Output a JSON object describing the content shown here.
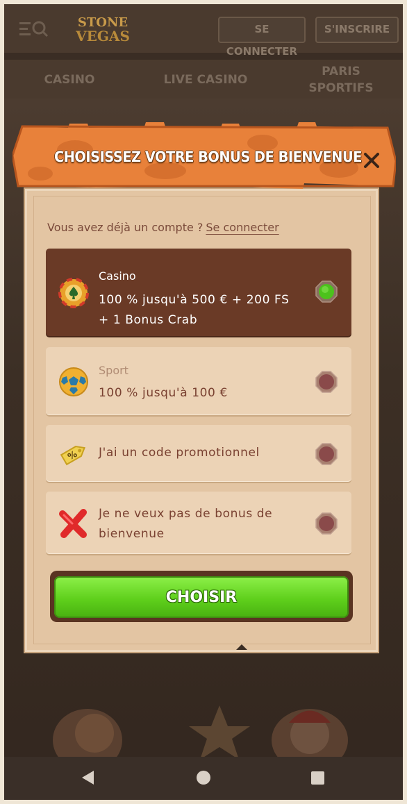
{
  "header": {
    "logo_top": "STONE",
    "logo_bottom": "VEGAS",
    "login_label": "SE CONNECTER",
    "register_label": "S'INSCRIRE"
  },
  "nav": {
    "tabs": [
      {
        "label": "CASINO"
      },
      {
        "label": "LIVE CASINO"
      },
      {
        "label": "PARIS SPORTIFS"
      }
    ]
  },
  "modal": {
    "title": "CHOISISSEZ VOTRE BONUS DE BIENVENUE",
    "account_prompt": "Vous avez déjà un compte ?",
    "account_link": "Se connecter",
    "options": [
      {
        "category": "Casino",
        "line1": "100 % jusqu'à 500 € + 200 FS",
        "line2": "+ 1 Bonus Crab",
        "icon": "casino-chip-icon",
        "selected": true
      },
      {
        "category": "Sport",
        "line1": "100 % jusqu'à 100 €",
        "icon": "soccer-ball-icon",
        "selected": false
      },
      {
        "line1": "J'ai un code promotionnel",
        "icon": "promo-tag-icon",
        "selected": false
      },
      {
        "line1": "Je ne veux pas de bonus de",
        "line2": "bienvenue",
        "icon": "red-cross-icon",
        "selected": false
      }
    ],
    "choose_label": "CHOISIR"
  },
  "colors": {
    "selected_bg": "#6a3a26",
    "option_bg": "#ecd3b6",
    "button_green": "#5fd01c",
    "banner_orange": "#e8813a"
  }
}
